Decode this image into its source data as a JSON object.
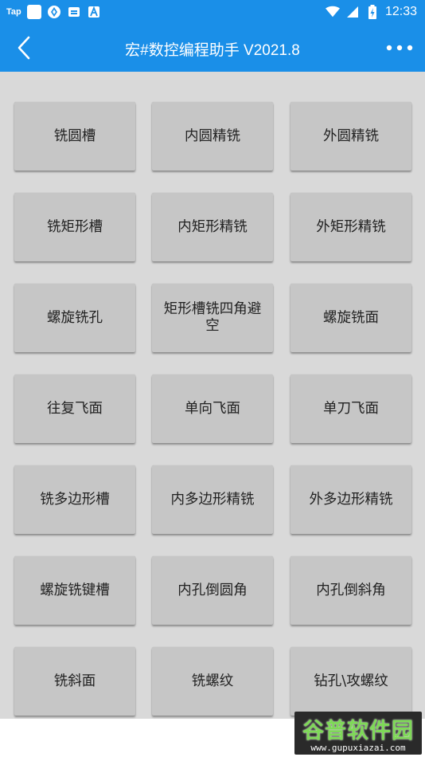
{
  "status_bar": {
    "carrier_label": "Tap",
    "time": "12:33",
    "icons": [
      "app-square-icon",
      "app-diamond-icon",
      "notification-icon",
      "font-a-icon",
      "wifi-icon",
      "signal-icon",
      "battery-icon"
    ]
  },
  "app_bar": {
    "title": "宏#数控编程助手 V2021.8",
    "color": "#1a8fe8"
  },
  "buttons": [
    {
      "label": "铣圆槽"
    },
    {
      "label": "内圆精铣"
    },
    {
      "label": "外圆精铣"
    },
    {
      "label": "铣矩形槽"
    },
    {
      "label": "内矩形精铣"
    },
    {
      "label": "外矩形精铣"
    },
    {
      "label": "螺旋铣孔"
    },
    {
      "label": "矩形槽铣四角避空"
    },
    {
      "label": "螺旋铣面"
    },
    {
      "label": "往复飞面"
    },
    {
      "label": "单向飞面"
    },
    {
      "label": "单刀飞面"
    },
    {
      "label": "铣多边形槽"
    },
    {
      "label": "内多边形精铣"
    },
    {
      "label": "外多边形精铣"
    },
    {
      "label": "螺旋铣键槽"
    },
    {
      "label": "内孔倒圆角"
    },
    {
      "label": "内孔倒斜角"
    },
    {
      "label": "铣斜面"
    },
    {
      "label": "铣螺纹"
    },
    {
      "label": "钻孔\\攻螺纹"
    }
  ],
  "watermark": {
    "brand": "谷普软件园",
    "url": "www.gupuxiazai.com"
  }
}
